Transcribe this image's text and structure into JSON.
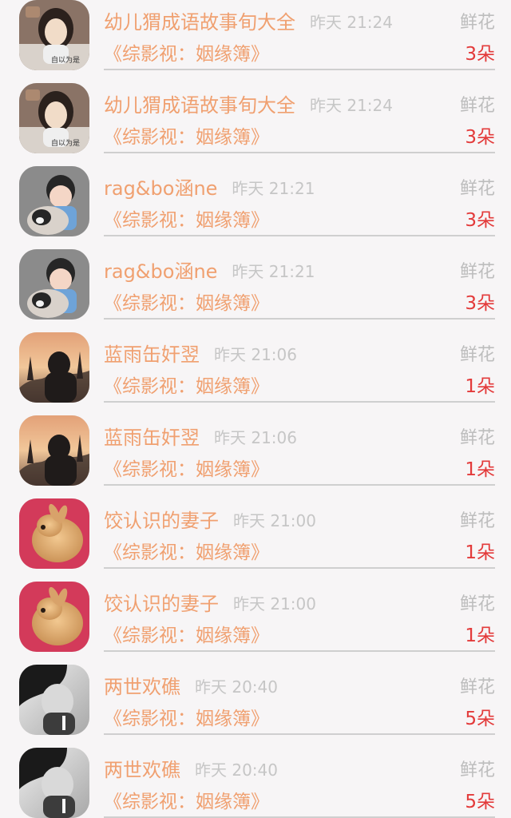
{
  "items": [
    {
      "name": "幼儿猬成语故事旬大全",
      "time": "昨天 21:24",
      "gift": "鲜花",
      "book": "《综影视：姻缘簿》",
      "count": "3朵",
      "avatar": "woman-portrait",
      "avatar_text": "自以为是"
    },
    {
      "name": "幼儿猬成语故事旬大全",
      "time": "昨天 21:24",
      "gift": "鲜花",
      "book": "《综影视：姻缘簿》",
      "count": "3朵",
      "avatar": "woman-portrait",
      "avatar_text": "自以为是"
    },
    {
      "name": "rag&bo涵ne",
      "time": "昨天 21:21",
      "gift": "鲜花",
      "book": "《综影视：姻缘簿》",
      "count": "3朵",
      "avatar": "child-with-dog"
    },
    {
      "name": "rag&bo涵ne",
      "time": "昨天 21:21",
      "gift": "鲜花",
      "book": "《综影视：姻缘簿》",
      "count": "3朵",
      "avatar": "child-with-dog"
    },
    {
      "name": "蓝雨缶奸翌",
      "time": "昨天 21:06",
      "gift": "鲜花",
      "book": "《综影视：姻缘簿》",
      "count": "1朵",
      "avatar": "silhouette-sunset"
    },
    {
      "name": "蓝雨缶奸翌",
      "time": "昨天 21:06",
      "gift": "鲜花",
      "book": "《综影视：姻缘簿》",
      "count": "1朵",
      "avatar": "silhouette-sunset"
    },
    {
      "name": "饺认识的妻子",
      "time": "昨天 21:00",
      "gift": "鲜花",
      "book": "《综影视：姻缘簿》",
      "count": "1朵",
      "avatar": "bunny"
    },
    {
      "name": "饺认识的妻子",
      "time": "昨天 21:00",
      "gift": "鲜花",
      "book": "《综影视：姻缘簿》",
      "count": "1朵",
      "avatar": "bunny"
    },
    {
      "name": "两世欢礁",
      "time": "昨天 20:40",
      "gift": "鲜花",
      "book": "《综影视：姻缘簿》",
      "count": "5朵",
      "avatar": "bw-woman"
    },
    {
      "name": "两世欢礁",
      "time": "昨天 20:40",
      "gift": "鲜花",
      "book": "《综影视：姻缘簿》",
      "count": "5朵",
      "avatar": "bw-woman"
    }
  ],
  "colors": {
    "name": "#f0a070",
    "count": "#e33a3a",
    "muted": "#c6c6c6",
    "background": "#f7f5f6"
  }
}
